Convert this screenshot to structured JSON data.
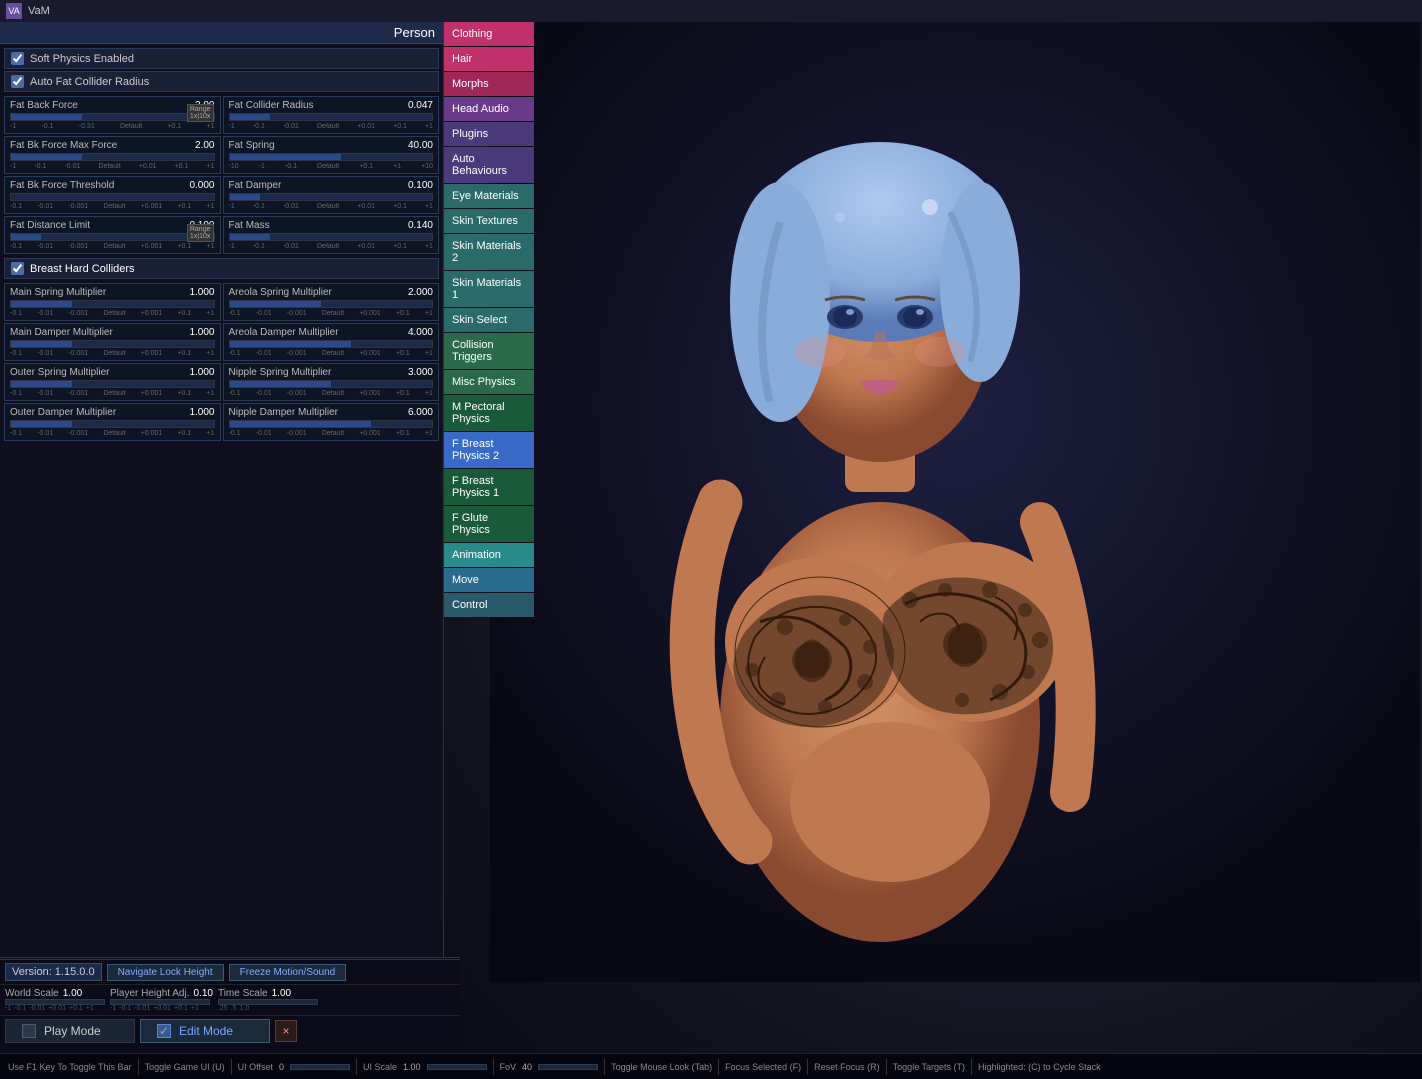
{
  "titleBar": {
    "appName": "VaM",
    "logoText": "VA"
  },
  "personHeader": "Person",
  "checkboxes": {
    "softPhysics": {
      "label": "Soft Physics Enabled",
      "checked": true
    },
    "autoFat": {
      "label": "Auto Fat Collider Radius",
      "checked": true
    },
    "breastHard": {
      "label": "Breast Hard Colliders",
      "checked": true
    }
  },
  "leftColumn": [
    {
      "name": "Fat Back Force",
      "value": "2.00",
      "fillPct": 35
    },
    {
      "name": "Fat Bk Force Max Force",
      "value": "2.00",
      "fillPct": 35
    },
    {
      "name": "Fat Bk Force Threshold",
      "value": "0.000",
      "fillPct": 0
    },
    {
      "name": "Fat Distance Limit",
      "value": "0.100",
      "fillPct": 15
    }
  ],
  "rightColumn": [
    {
      "name": "Fat Collider Radius",
      "value": "0.047",
      "fillPct": 20
    },
    {
      "name": "Fat Spring",
      "value": "40.00",
      "fillPct": 55
    },
    {
      "name": "Fat Damper",
      "value": "0.100",
      "fillPct": 15
    },
    {
      "name": "Fat Mass",
      "value": "0.140",
      "fillPct": 20
    }
  ],
  "multiplierControls": [
    {
      "col": "left",
      "name": "Main Spring Multiplier",
      "value": "1.000",
      "fillPct": 30
    },
    {
      "col": "right",
      "name": "Areola Spring Multiplier",
      "value": "2.000",
      "fillPct": 45
    },
    {
      "col": "left",
      "name": "Main Damper Multiplier",
      "value": "1.000",
      "fillPct": 30
    },
    {
      "col": "right",
      "name": "Areola Damper Multiplier",
      "value": "4.000",
      "fillPct": 60
    },
    {
      "col": "left",
      "name": "Outer Spring Multiplier",
      "value": "1.000",
      "fillPct": 30
    },
    {
      "col": "right",
      "name": "Nipple Spring Multiplier",
      "value": "3.000",
      "fillPct": 50
    },
    {
      "col": "left",
      "name": "Outer Damper Multiplier",
      "value": "1.000",
      "fillPct": 30
    },
    {
      "col": "right",
      "name": "Nipple Damper Multiplier",
      "value": "6.000",
      "fillPct": 70
    }
  ],
  "tickLabels": [
    "-1",
    "-0.1",
    "-0.01",
    "Default",
    "-0.001",
    "+0.1",
    "+1"
  ],
  "tickLabels2": [
    "-10",
    "-1",
    "-0.1",
    "Default",
    "+0.1",
    "+1",
    "+10"
  ],
  "navItems": [
    {
      "id": "clothing",
      "label": "Clothing",
      "class": "pink"
    },
    {
      "id": "hair",
      "label": "Hair",
      "class": "pink"
    },
    {
      "id": "morphs",
      "label": "Morphs",
      "class": "dark-pink"
    },
    {
      "id": "head-audio",
      "label": "Head Audio",
      "class": "purple"
    },
    {
      "id": "plugins",
      "label": "Plugins",
      "class": "blue-purple"
    },
    {
      "id": "auto-behaviours",
      "label": "Auto Behaviours",
      "class": "blue-purple"
    },
    {
      "id": "eye-materials",
      "label": "Eye Materials",
      "class": "teal"
    },
    {
      "id": "skin-textures",
      "label": "Skin Textures",
      "class": "teal"
    },
    {
      "id": "skin-materials-2",
      "label": "Skin Materials 2",
      "class": "teal"
    },
    {
      "id": "skin-materials-1",
      "label": "Skin Materials 1",
      "class": "teal"
    },
    {
      "id": "skin-select",
      "label": "Skin Select",
      "class": "teal"
    },
    {
      "id": "collision-triggers",
      "label": "Collision Triggers",
      "class": "green"
    },
    {
      "id": "misc-physics",
      "label": "Misc Physics",
      "class": "green"
    },
    {
      "id": "m-pectoral-physics",
      "label": "M Pectoral Physics",
      "class": "dark-green"
    },
    {
      "id": "f-breast-physics-2",
      "label": "F Breast Physics 2",
      "class": "active"
    },
    {
      "id": "f-breast-physics-1",
      "label": "F Breast Physics 1",
      "class": "dark-green"
    },
    {
      "id": "f-glute-physics",
      "label": "F Glute Physics",
      "class": "dark-green"
    },
    {
      "id": "animation",
      "label": "Animation",
      "class": "cyan"
    },
    {
      "id": "move",
      "label": "Move",
      "class": "move"
    },
    {
      "id": "control",
      "label": "Control",
      "class": "control"
    }
  ],
  "toolbar": {
    "icons": [
      "☰",
      "💾",
      "↩",
      "☁",
      "🌿",
      "👤",
      "➤",
      "⚙",
      "⇄"
    ],
    "powerIcon": "⏻"
  },
  "statusBar": {
    "version": "Version: 1.15.0.0",
    "navigateLockHeight": "Navigate Lock Height",
    "freezeMotion": "Freeze Motion/Sound",
    "playerHeightAdj": "Player Height Adj.",
    "playerHeightVal": "0.10",
    "timeScale": "Time Scale",
    "timeScaleVal": "1.00",
    "worldScale": "World Scale",
    "worldScaleVal": "1.00"
  },
  "modeButtons": {
    "playMode": "Play Mode",
    "editMode": "Edit Mode",
    "closeLabel": "×"
  },
  "infoBar": {
    "f1hint": "Use F1 Key To Toggle This Bar",
    "toggleGameUI": "Toggle Game UI (U)",
    "uiOffset": "UI Offset",
    "uiOffsetVal": "0",
    "uiScale": "UI Scale",
    "uiScaleVal": "1.00",
    "fov": "FoV",
    "fovVal": "40",
    "toggleMouse": "Toggle Mouse Look (Tab)",
    "focusSelected": "Focus Selected (F)",
    "resetFocus": "Reset Focus (R)",
    "toggleTargets": "Toggle Targets (T)",
    "highlighted": "Highlighted: (C) to Cycle Stack"
  }
}
